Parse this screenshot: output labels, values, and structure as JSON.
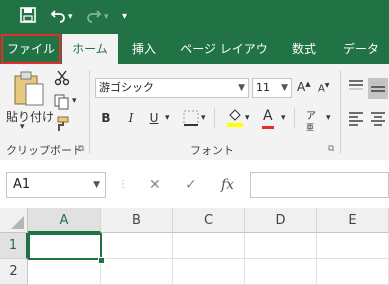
{
  "quick_access": {
    "save_icon": "save-icon",
    "undo_icon": "undo-icon",
    "redo_icon": "redo-icon",
    "customize_icon": "customize-qat-icon"
  },
  "tabs": [
    {
      "label": "ファイル"
    },
    {
      "label": "ホーム"
    },
    {
      "label": "挿入"
    },
    {
      "label": "ページ レイアウト"
    },
    {
      "label": "数式"
    },
    {
      "label": "データ"
    }
  ],
  "clipboard": {
    "paste_label": "貼り付け",
    "group_label": "クリップボード"
  },
  "font": {
    "name": "游ゴシック",
    "size": "11",
    "group_label": "フォント",
    "bold": "B",
    "italic": "I",
    "underline": "U",
    "font_color_label": "A"
  },
  "namebox": {
    "value": "A1"
  },
  "formula": {
    "cancel": "✕",
    "enter": "✓",
    "fx": "fx"
  },
  "columns": [
    "A",
    "B",
    "C",
    "D",
    "E"
  ],
  "rows": [
    "1",
    "2"
  ],
  "colors": {
    "accent": "#217346",
    "highlight_border": "#e52d2d"
  }
}
